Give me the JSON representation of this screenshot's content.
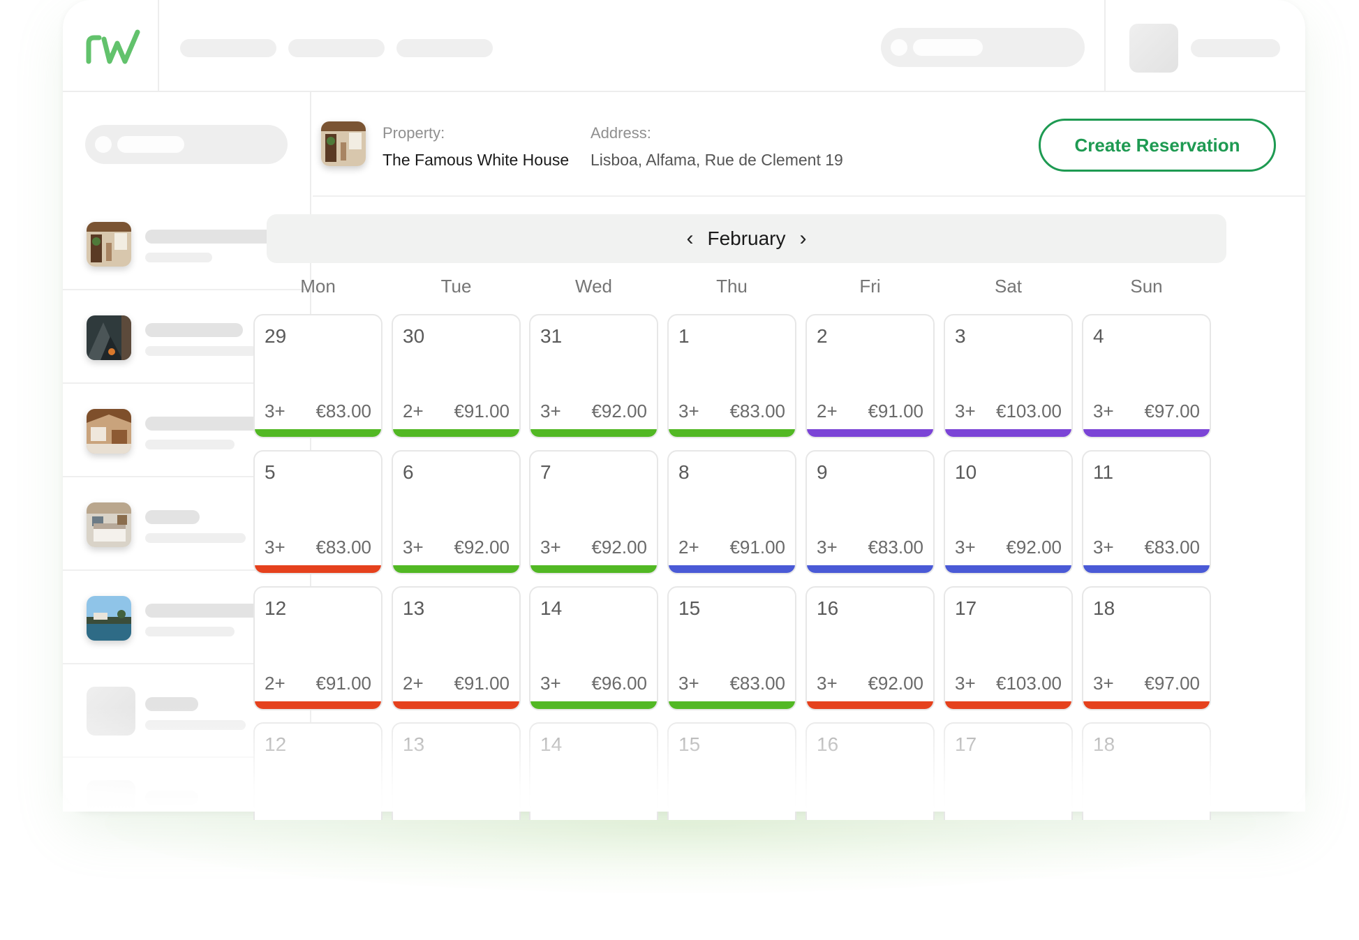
{
  "property_label": "Property:",
  "property_name": "The Famous White House",
  "address_label": "Address:",
  "address_value": "Lisboa, Alfama,  Rue de Clement 19",
  "create_button": "Create Reservation",
  "month": "February",
  "weekdays": [
    "Mon",
    "Tue",
    "Wed",
    "Thu",
    "Fri",
    "Sat",
    "Sun"
  ],
  "status_colors": {
    "green": "#52b824",
    "purple": "#7b44d6",
    "blue": "#4a5ad6",
    "red": "#e5411d"
  },
  "weeks": [
    [
      {
        "day": "29",
        "guests": "3+",
        "price": "€83.00",
        "status": "green"
      },
      {
        "day": "30",
        "guests": "2+",
        "price": "€91.00",
        "status": "green"
      },
      {
        "day": "31",
        "guests": "3+",
        "price": "€92.00",
        "status": "green"
      },
      {
        "day": "1",
        "guests": "3+",
        "price": "€83.00",
        "status": "green"
      },
      {
        "day": "2",
        "guests": "2+",
        "price": "€91.00",
        "status": "purple"
      },
      {
        "day": "3",
        "guests": "3+",
        "price": "€103.00",
        "status": "purple"
      },
      {
        "day": "4",
        "guests": "3+",
        "price": "€97.00",
        "status": "purple"
      }
    ],
    [
      {
        "day": "5",
        "guests": "3+",
        "price": "€83.00",
        "status": "red"
      },
      {
        "day": "6",
        "guests": "3+",
        "price": "€92.00",
        "status": "green"
      },
      {
        "day": "7",
        "guests": "3+",
        "price": "€92.00",
        "status": "green"
      },
      {
        "day": "8",
        "guests": "2+",
        "price": "€91.00",
        "status": "blue"
      },
      {
        "day": "9",
        "guests": "3+",
        "price": "€83.00",
        "status": "blue"
      },
      {
        "day": "10",
        "guests": "3+",
        "price": "€92.00",
        "status": "blue"
      },
      {
        "day": "11",
        "guests": "3+",
        "price": "€83.00",
        "status": "blue"
      }
    ],
    [
      {
        "day": "12",
        "guests": "2+",
        "price": "€91.00",
        "status": "red"
      },
      {
        "day": "13",
        "guests": "2+",
        "price": "€91.00",
        "status": "red"
      },
      {
        "day": "14",
        "guests": "3+",
        "price": "€96.00",
        "status": "green"
      },
      {
        "day": "15",
        "guests": "3+",
        "price": "€83.00",
        "status": "green"
      },
      {
        "day": "16",
        "guests": "3+",
        "price": "€92.00",
        "status": "red"
      },
      {
        "day": "17",
        "guests": "3+",
        "price": "€103.00",
        "status": "red"
      },
      {
        "day": "18",
        "guests": "3+",
        "price": "€97.00",
        "status": "red"
      }
    ],
    [
      {
        "day": "12"
      },
      {
        "day": "13"
      },
      {
        "day": "14"
      },
      {
        "day": "15"
      },
      {
        "day": "16"
      },
      {
        "day": "17"
      },
      {
        "day": "18"
      }
    ]
  ]
}
